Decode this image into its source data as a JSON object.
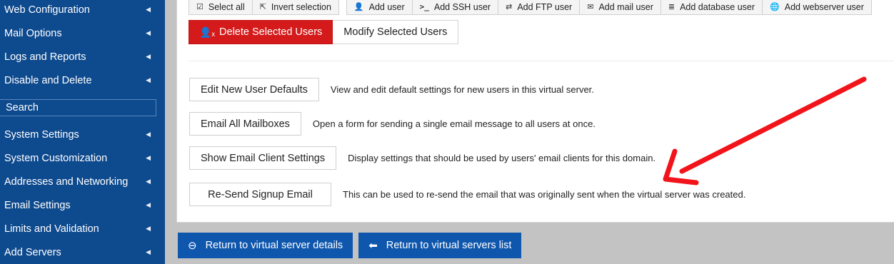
{
  "sidebar": {
    "items": [
      {
        "label": "Web Configuration"
      },
      {
        "label": "Mail Options"
      },
      {
        "label": "Logs and Reports"
      },
      {
        "label": "Disable and Delete"
      },
      {
        "label": "System Settings"
      },
      {
        "label": "System Customization"
      },
      {
        "label": "Addresses and Networking"
      },
      {
        "label": "Email Settings"
      },
      {
        "label": "Limits and Validation"
      },
      {
        "label": "Add Servers"
      }
    ],
    "search_placeholder": "Search"
  },
  "toolbar": {
    "select_all": "Select all",
    "invert_selection": "Invert selection",
    "add_user": "Add user",
    "add_ssh_user": "Add SSH user",
    "add_ftp_user": "Add FTP user",
    "add_mail_user": "Add mail user",
    "add_database_user": "Add database user",
    "add_webserver_user": "Add webserver user"
  },
  "actions": {
    "delete_selected": "Delete Selected Users",
    "modify_selected": "Modify Selected Users"
  },
  "options": [
    {
      "button": "Edit New User Defaults",
      "description": "View and edit default settings for new users in this virtual server."
    },
    {
      "button": "Email All Mailboxes",
      "description": "Open a form for sending a single email message to all users at once."
    },
    {
      "button": "Show Email Client Settings",
      "description": "Display settings that should be used by users' email clients for this domain."
    },
    {
      "button": "Re-Send Signup Email",
      "description": "This can be used to re-send the email that was originally sent when the virtual server was created."
    }
  ],
  "footer": {
    "return_details": "Return to virtual server details",
    "return_list": "Return to virtual servers list"
  },
  "colors": {
    "sidebar_bg": "#0e4a8e",
    "danger": "#d41a1a",
    "primary_button": "#0f56ad",
    "annotation_arrow": "#f2141b"
  }
}
